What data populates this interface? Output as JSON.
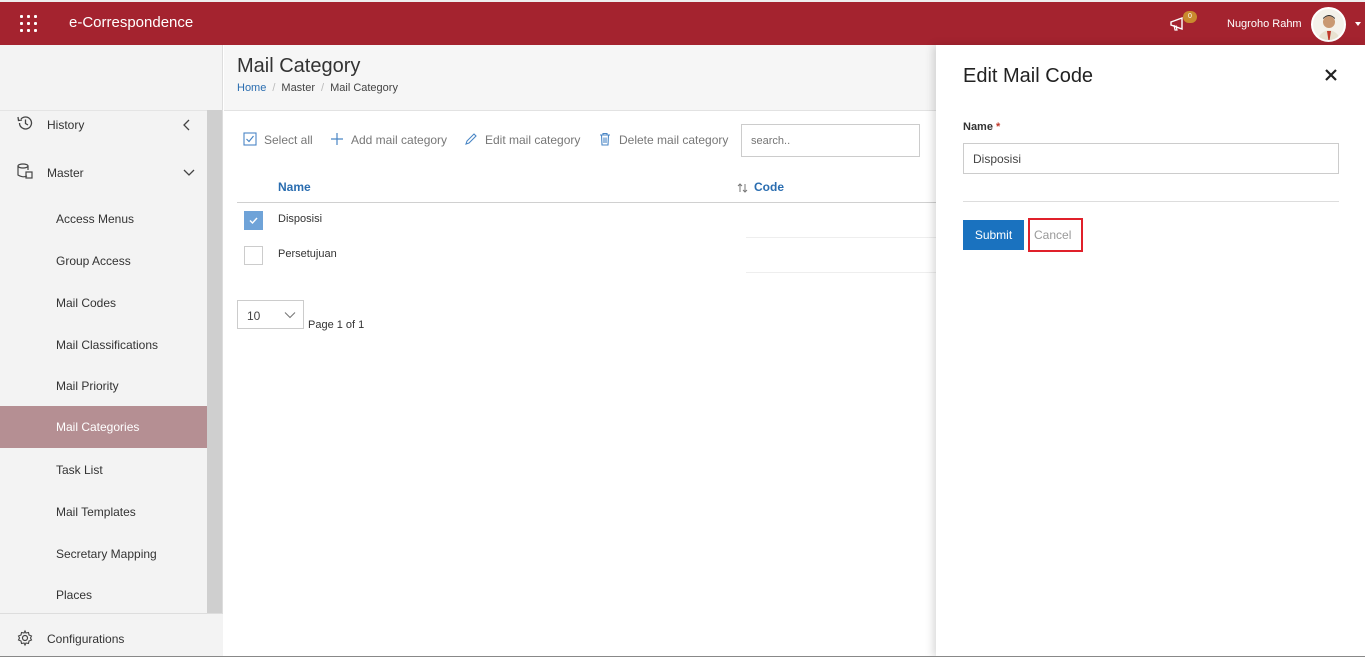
{
  "header": {
    "app_title": "e-Correspondence",
    "notification_count": "0",
    "user_name": "Nugroho Rahm"
  },
  "sidebar": {
    "items": [
      {
        "label": "History",
        "type": "parent",
        "icon": "history-icon"
      },
      {
        "label": "Master",
        "type": "parent",
        "icon": "database-icon"
      },
      {
        "label": "Access Menus",
        "type": "child"
      },
      {
        "label": "Group Access",
        "type": "child"
      },
      {
        "label": "Mail Codes",
        "type": "child"
      },
      {
        "label": "Mail Classifications",
        "type": "child"
      },
      {
        "label": "Mail Priority",
        "type": "child"
      },
      {
        "label": "Mail Categories",
        "type": "child",
        "active": true
      },
      {
        "label": "Task List",
        "type": "child"
      },
      {
        "label": "Mail Templates",
        "type": "child"
      },
      {
        "label": "Secretary Mapping",
        "type": "child"
      },
      {
        "label": "Places",
        "type": "child"
      }
    ],
    "bottom": {
      "label": "Configurations",
      "icon": "gear-icon"
    }
  },
  "page": {
    "title": "Mail Category",
    "breadcrumb": [
      "Home",
      "Master",
      "Mail Category"
    ]
  },
  "toolbar": {
    "select_all": "Select all",
    "add": "Add mail category",
    "edit": "Edit mail category",
    "delete": "Delete mail category",
    "search_placeholder": "search.."
  },
  "table": {
    "columns": [
      "Name",
      "Code"
    ],
    "rows": [
      {
        "name": "Disposisi",
        "code": "",
        "checked": true
      },
      {
        "name": "Persetujuan",
        "code": "",
        "checked": false
      }
    ]
  },
  "pager": {
    "page_size": "10",
    "page_text": "Page 1 of 1"
  },
  "panel": {
    "title": "Edit Mail Code",
    "name_label": "Name",
    "required_mark": "*",
    "name_value": "Disposisi",
    "submit_label": "Submit",
    "cancel_label": "Cancel"
  },
  "colors": {
    "brand": "#a4232f",
    "active_menu": "#b58f93",
    "link": "#2a6db0",
    "primary_button": "#1a72bf",
    "highlight": "#e0202a"
  }
}
